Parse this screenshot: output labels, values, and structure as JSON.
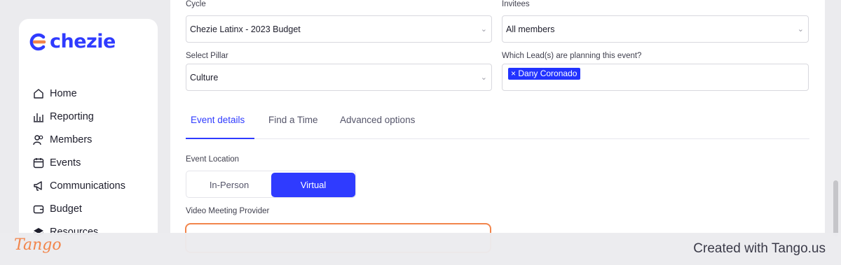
{
  "app": {
    "logo_text": "chezie",
    "brand_color": "#2f3bff",
    "logo_accent": "#f2854b"
  },
  "sidebar": {
    "items": [
      {
        "label": "Home",
        "icon": "home-icon"
      },
      {
        "label": "Reporting",
        "icon": "bar-chart-icon"
      },
      {
        "label": "Members",
        "icon": "users-icon"
      },
      {
        "label": "Events",
        "icon": "calendar-icon"
      },
      {
        "label": "Communications",
        "icon": "megaphone-icon"
      },
      {
        "label": "Budget",
        "icon": "wallet-icon"
      },
      {
        "label": "Resources",
        "icon": "layers-icon"
      }
    ]
  },
  "form": {
    "cycle": {
      "label": "Cycle",
      "value": "Chezie Latinx - 2023 Budget"
    },
    "invitees": {
      "label": "Invitees",
      "value": "All members"
    },
    "pillar": {
      "label": "Select Pillar",
      "value": "Culture"
    },
    "leads": {
      "label": "Which Lead(s) are planning this event?",
      "tags": [
        "Dany Coronado"
      ],
      "remove_glyph": "×"
    },
    "tabs": [
      {
        "label": "Event details",
        "active": true
      },
      {
        "label": "Find a Time",
        "active": false
      },
      {
        "label": "Advanced options",
        "active": false
      }
    ],
    "location": {
      "label": "Event Location",
      "options": [
        "In-Person",
        "Virtual"
      ],
      "selected": "Virtual"
    },
    "video_provider": {
      "label": "Video Meeting Provider",
      "value": ""
    }
  },
  "footer": {
    "tango_logo": "Tango",
    "created_text": "Created with Tango.us"
  }
}
